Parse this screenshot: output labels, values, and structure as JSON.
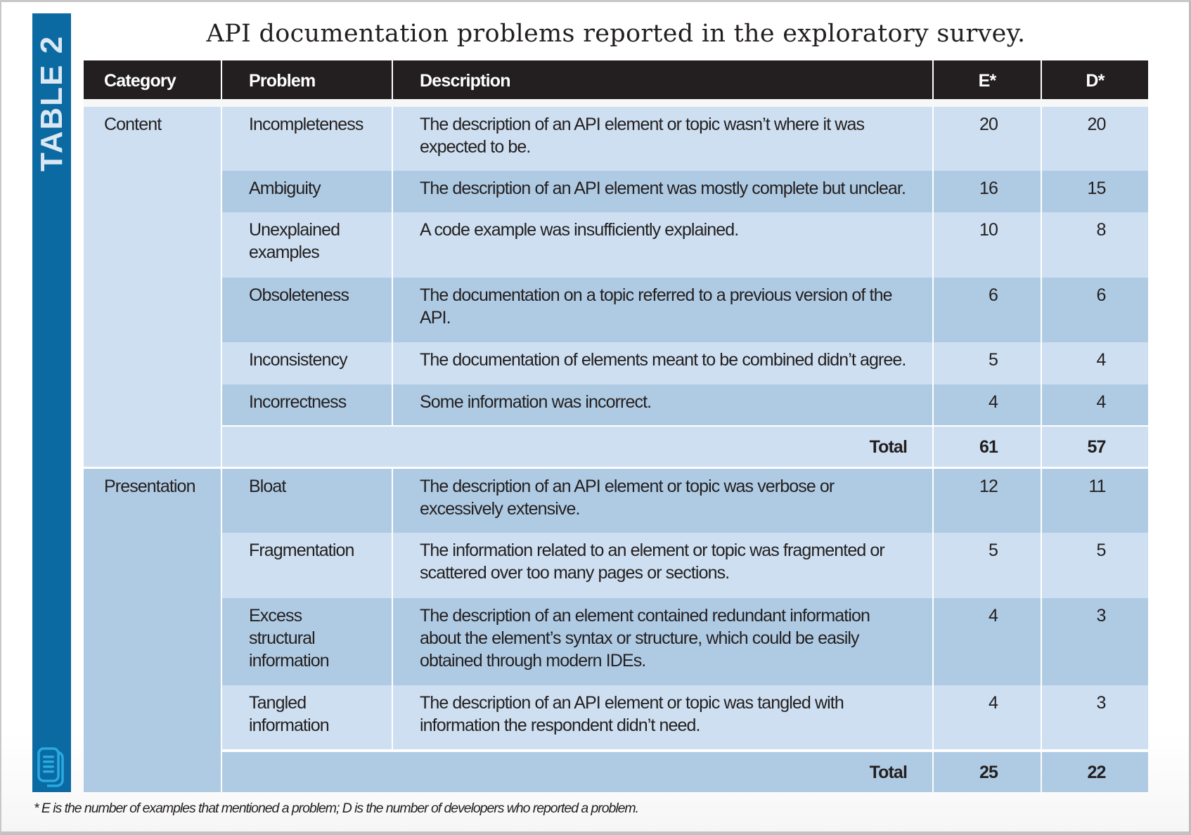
{
  "side_label": "TABLE 2",
  "title": "API documentation problems reported in the exploratory survey.",
  "header": {
    "category": "Category",
    "problem": "Problem",
    "description": "Description",
    "e": "E*",
    "d": "D*"
  },
  "groups": [
    {
      "category": "Content",
      "rows": [
        {
          "problem": [
            "Incompleteness"
          ],
          "description": [
            "The description of an API element or topic wasn’t where it was",
            "expected to be."
          ],
          "e": "20",
          "d": "20"
        },
        {
          "problem": [
            "Ambiguity"
          ],
          "description": [
            "The description of an API element was mostly complete but unclear."
          ],
          "e": "16",
          "d": "15"
        },
        {
          "problem": [
            "Unexplained",
            "examples"
          ],
          "description": [
            "A code example was insufficiently explained."
          ],
          "e": "10",
          "d": "8"
        },
        {
          "problem": [
            "Obsoleteness"
          ],
          "description": [
            "The documentation on a topic referred to a previous version of the",
            "API."
          ],
          "e": "6",
          "d": "6"
        },
        {
          "problem": [
            "Inconsistency"
          ],
          "description": [
            "The documentation of elements meant to be combined didn’t agree."
          ],
          "e": "5",
          "d": "4"
        },
        {
          "problem": [
            "Incorrectness"
          ],
          "description": [
            "Some information was incorrect."
          ],
          "e": "4",
          "d": "4"
        }
      ],
      "total": {
        "label": "Total",
        "e": "61",
        "d": "57"
      }
    },
    {
      "category": "Presentation",
      "rows": [
        {
          "problem": [
            "Bloat"
          ],
          "description": [
            "The description of an API element or topic was verbose or",
            "excessively extensive."
          ],
          "e": "12",
          "d": "11"
        },
        {
          "problem": [
            "Fragmentation"
          ],
          "description": [
            "The information related to an element or topic was fragmented or",
            "scattered over too many pages or sections."
          ],
          "e": "5",
          "d": "5"
        },
        {
          "problem": [
            "Excess",
            "structural",
            "information"
          ],
          "description": [
            "The description of an element contained redundant information",
            "about the element’s syntax or structure, which could be easily",
            "obtained through modern IDEs."
          ],
          "e": "4",
          "d": "3"
        },
        {
          "problem": [
            "Tangled",
            "information"
          ],
          "description": [
            "The description of an API element or topic was tangled with",
            "information the respondent didn’t need."
          ],
          "e": "4",
          "d": "3"
        }
      ],
      "total": {
        "label": "Total",
        "e": "25",
        "d": "22"
      }
    }
  ],
  "footnote": "* E is the number of examples that mentioned a problem; D is the number of developers who reported a problem.",
  "icons": {
    "side_icon": "document-stack-icon"
  },
  "colors": {
    "side_bar": "#0b6aa2",
    "header": "#231f20",
    "row_light": "#cddff0",
    "row_dark": "#afcbe3",
    "icon": "#29aae1"
  }
}
